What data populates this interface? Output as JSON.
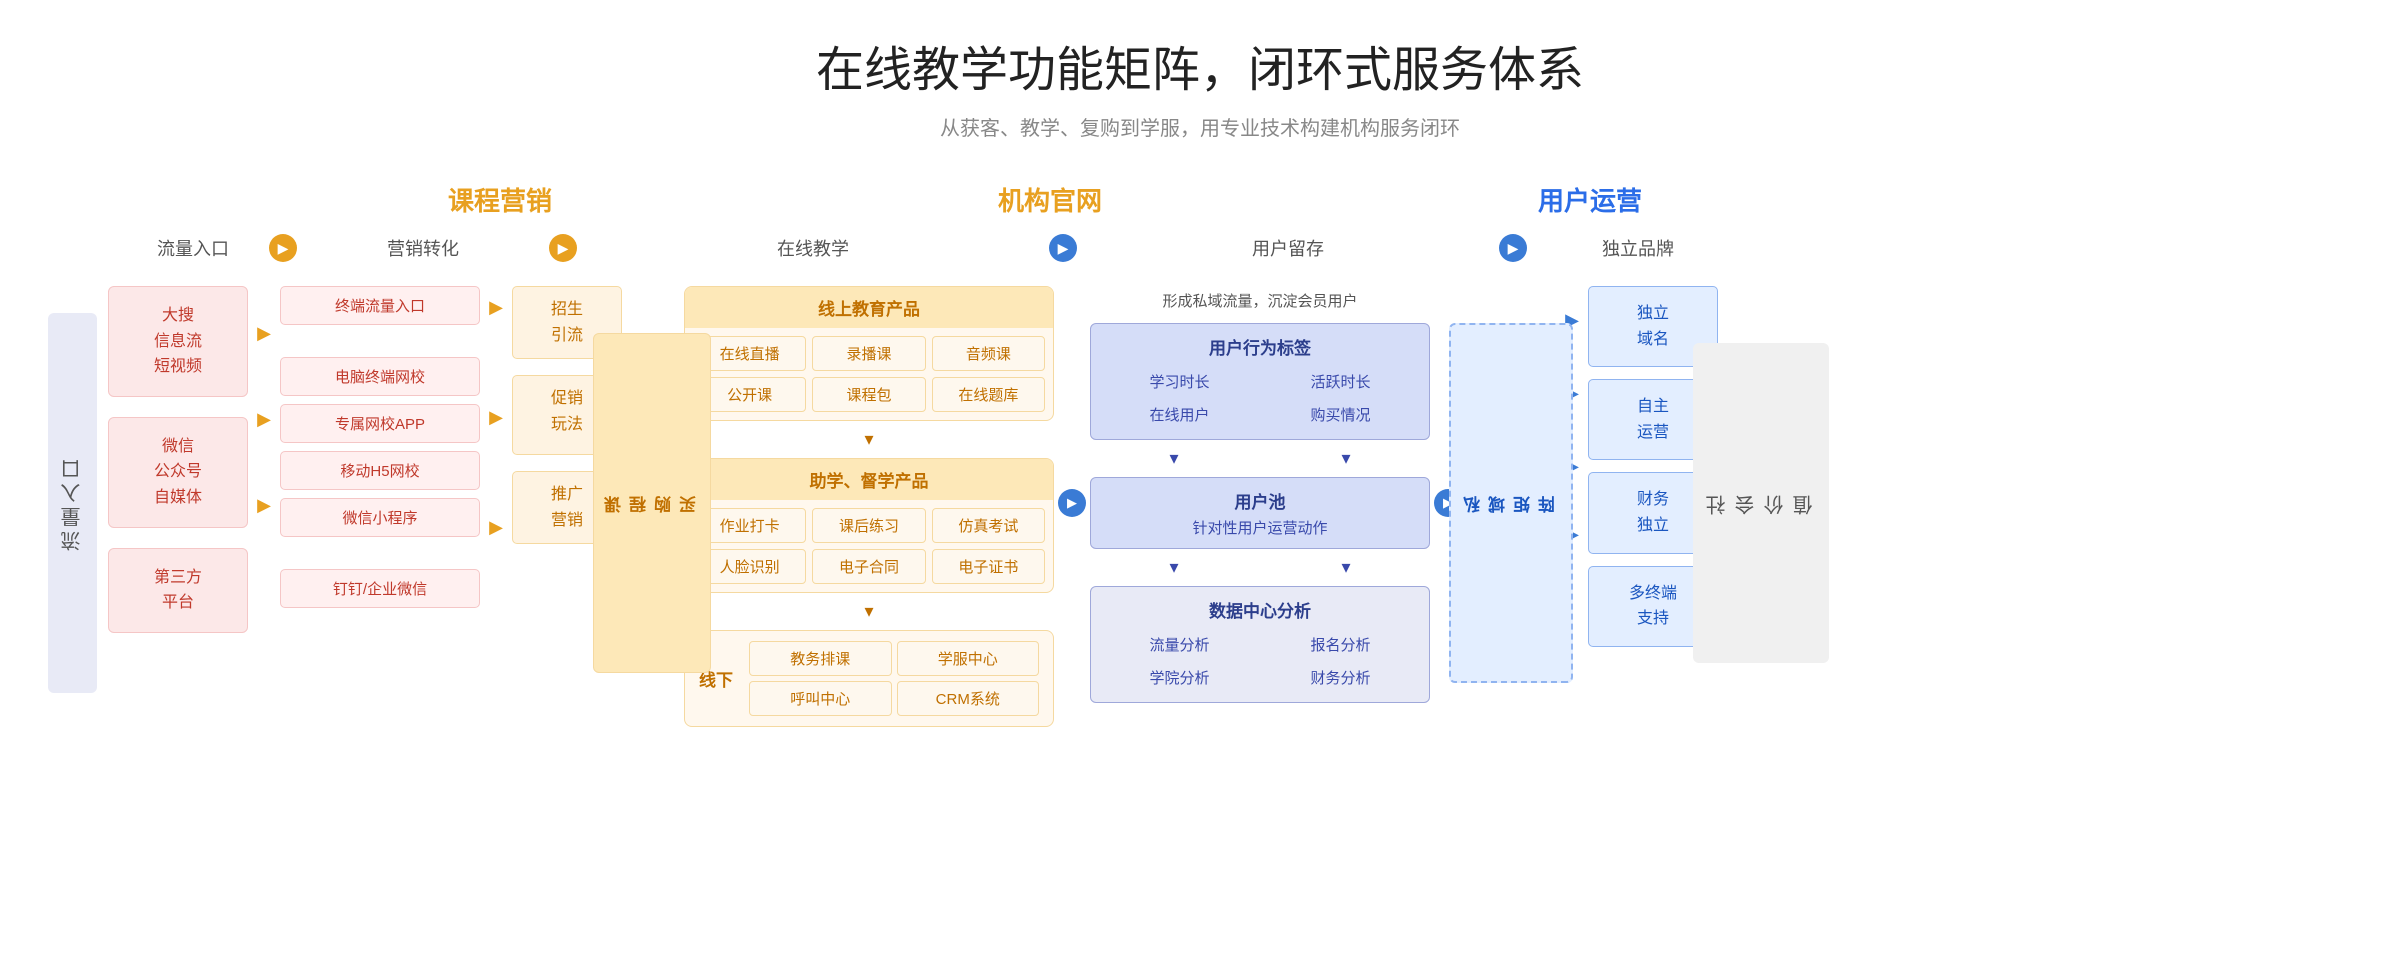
{
  "header": {
    "title": "在线教学功能矩阵，闭环式服务体系",
    "subtitle": "从获客、教学、复购到学服，用专业技术构建机构服务闭环"
  },
  "sections": {
    "marketing": "课程营销",
    "website": "机构官网",
    "user_ops": "用户运营"
  },
  "flow_labels": {
    "traffic_entry": "流量入口",
    "marketing_conversion": "营销转化",
    "online_teaching": "在线教学",
    "user_retention": "用户留存",
    "independent_brand": "独立品牌"
  },
  "left_label": "流量入口",
  "traffic_sources": [
    "大搜\n信息流\n短视频",
    "微信\n公众号\n自媒体",
    "第三方\n平台"
  ],
  "marketing_items": [
    "终端流量入口",
    "电脑终端网校",
    "专属网校APP",
    "移动H5网校",
    "微信小程序",
    "钉钉/企业微信"
  ],
  "buy_items": [
    "招生\n引流",
    "促销\n玩法",
    "推广\n营销"
  ],
  "course_purchase": "课\n程\n购\n买",
  "online_education": {
    "header": "线上教育产品",
    "items": [
      "在线直播",
      "录播课",
      "音频课",
      "公开课",
      "课程包",
      "在线题库"
    ]
  },
  "assist_supervision": {
    "header": "助学、督学产品",
    "items": [
      "作业打卡",
      "课后练习",
      "仿真考试",
      "人脸识别",
      "电子合同",
      "电子证书"
    ]
  },
  "offline": {
    "label": "线下",
    "items": [
      "教务排课",
      "学服中心",
      "呼叫中心",
      "CRM系统"
    ]
  },
  "user_retention": {
    "private_flow_text": "形成私域流量，沉淀会员用户",
    "behavior_tag": {
      "header": "用户行为标签",
      "items": [
        "学习时长",
        "活跃时长",
        "在线用户",
        "购买情况"
      ]
    },
    "user_pool": {
      "title": "用户池",
      "subtitle": "针对性用户运营动作"
    },
    "data_center": {
      "header": "数据中心分析",
      "items": [
        "流量分析",
        "报名分析",
        "学院分析",
        "财务分析"
      ]
    }
  },
  "private_domain": "私\n域\n矩\n阵",
  "brand_items": [
    "独立\n域名",
    "自主\n运营",
    "财务\n独立",
    "多终端\n支持"
  ],
  "right_label": "社\n会\n价\n值",
  "arrows": {
    "orange_circle": "▶",
    "blue_circle": "▶",
    "down_arrow": "▾",
    "right_arrow": "▶"
  }
}
